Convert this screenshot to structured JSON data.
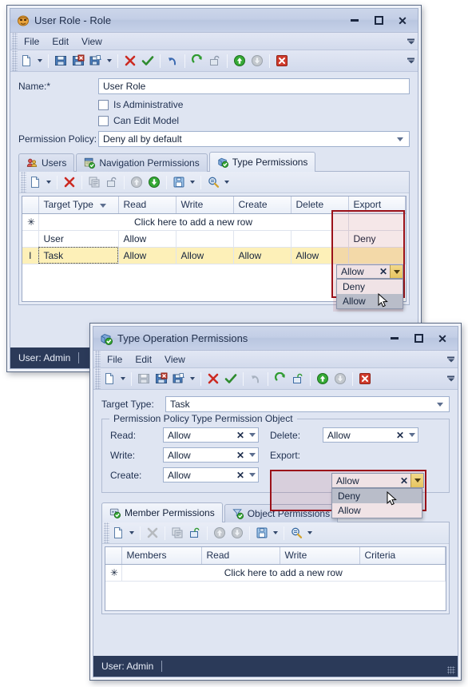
{
  "window1": {
    "title": "User Role - Role",
    "icon": "theater-mask-icon",
    "buttons": {
      "minimize": "–",
      "maximize": "□",
      "close": "✕"
    },
    "menu": [
      "File",
      "Edit",
      "View"
    ],
    "toolbar_icons": [
      "new-document-icon",
      "new-dropdown-caret",
      "save-icon",
      "save-close-icon",
      "save-new-icon",
      "save-dropdown-caret",
      "delete-icon",
      "ok-icon",
      "undo-icon",
      "refresh-icon",
      "unlock-icon",
      "move-up-icon",
      "move-down-icon",
      "cancel-icon"
    ],
    "form": {
      "name_label": "Name:*",
      "name_value": "User Role",
      "is_administrative_label": "Is Administrative",
      "is_administrative_checked": false,
      "can_edit_model_label": "Can Edit Model",
      "can_edit_model_checked": false,
      "permission_policy_label": "Permission Policy:",
      "permission_policy_value": "Deny all by default"
    },
    "tabs": [
      {
        "label": "Users",
        "icon": "users-icon",
        "active": false
      },
      {
        "label": "Navigation Permissions",
        "icon": "navigation-permissions-icon",
        "active": false
      },
      {
        "label": "Type Permissions",
        "icon": "type-permissions-icon",
        "active": true
      }
    ],
    "grid_toolbar_icons": [
      "new-row-icon",
      "new-row-caret",
      "delete-row-icon",
      "edit-row-icon",
      "unlock-row-icon",
      "move-up-icon",
      "move-down-icon",
      "save-grid-icon",
      "save-grid-caret",
      "filter-icon",
      "more-icon"
    ],
    "grid": {
      "columns": [
        "Target Type",
        "Read",
        "Write",
        "Create",
        "Delete",
        "Export"
      ],
      "sorted_column": "Target Type",
      "new_row_text": "Click here to add a new row",
      "rows": [
        {
          "indicator": "",
          "selected": false,
          "cells": [
            "User",
            "Allow",
            "",
            "",
            "",
            "Deny"
          ]
        },
        {
          "indicator": "I",
          "selected": true,
          "cells": [
            "Task",
            "Allow",
            "Allow",
            "Allow",
            "Allow",
            "Allow"
          ]
        }
      ]
    },
    "export_editor": {
      "value": "Allow",
      "clear_glyph": "✕",
      "options": [
        "Deny",
        "Allow"
      ],
      "hovered_option": "Allow"
    },
    "status": {
      "user": "User: Admin"
    }
  },
  "window2": {
    "title": "Type Operation Permissions",
    "icon": "type-permissions-icon",
    "buttons": {
      "minimize": "–",
      "maximize": "□",
      "close": "✕"
    },
    "menu": [
      "File",
      "Edit",
      "View"
    ],
    "toolbar_icons": [
      "new-document-icon",
      "new-dropdown-caret",
      "save-icon",
      "save-close-icon",
      "save-new-icon",
      "save-dropdown-caret",
      "delete-icon",
      "ok-icon",
      "undo-icon",
      "refresh-icon",
      "unlock-icon",
      "move-up-icon",
      "move-down-icon",
      "cancel-icon"
    ],
    "form": {
      "target_type_label": "Target Type:",
      "target_type_value": "Task",
      "group_title": "Permission Policy Type Permission Object",
      "fields": [
        {
          "label": "Read:",
          "value": "Allow",
          "clear_glyph": "✕"
        },
        {
          "label": "Write:",
          "value": "Allow",
          "clear_glyph": "✕"
        },
        {
          "label": "Create:",
          "value": "Allow",
          "clear_glyph": "✕"
        },
        {
          "label": "Delete:",
          "value": "Allow",
          "clear_glyph": "✕"
        }
      ],
      "export_field": {
        "label": "Export:",
        "value": "Allow",
        "clear_glyph": "✕",
        "options": [
          "Deny",
          "Allow"
        ],
        "hovered_option": "Deny"
      }
    },
    "tabs": [
      {
        "label": "Member Permissions",
        "icon": "member-permissions-icon",
        "active": true
      },
      {
        "label": "Object Permissions",
        "icon": "object-permissions-icon",
        "active": false
      }
    ],
    "grid_toolbar_icons": [
      "new-row-icon",
      "new-row-caret",
      "delete-row-icon",
      "edit-row-icon",
      "unlock-row-icon",
      "move-up-icon",
      "move-down-icon",
      "save-grid-icon",
      "save-grid-caret",
      "filter-icon",
      "more-icon"
    ],
    "grid": {
      "columns": [
        "Members",
        "Read",
        "Write",
        "Criteria"
      ],
      "new_row_text": "Click here to add a new row",
      "rows": []
    },
    "status": {
      "user": "User: Admin"
    }
  },
  "colors": {
    "highlight_border": "#9b1119",
    "title_bar": "#c3cee6",
    "status_bar": "#2b3a59",
    "selected_row": "#fdf0b8",
    "dropdown_button": "#e6c560",
    "accent_text": "#1f3050"
  }
}
